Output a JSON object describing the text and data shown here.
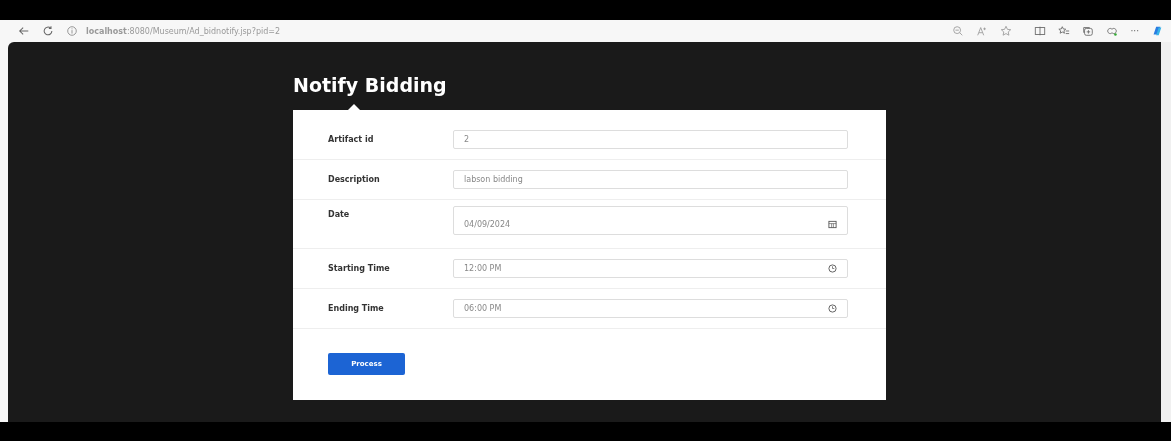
{
  "browser": {
    "address": "**localhost**:8080/Museum/Ad_bidnotify.jsp?pid=2",
    "more": "···"
  },
  "page": {
    "title": "Notify Bidding",
    "fields": [
      {
        "label": "Artifact id",
        "value": "2",
        "kind": "text"
      },
      {
        "label": "Description",
        "value": "labson bidding",
        "kind": "text"
      },
      {
        "label": "Date",
        "value": "04/09/2024",
        "kind": "date"
      },
      {
        "label": "Starting Time",
        "value": "12:00 PM",
        "kind": "time"
      },
      {
        "label": "Ending Time",
        "value": "06:00 PM",
        "kind": "time"
      }
    ],
    "button": "Process"
  }
}
